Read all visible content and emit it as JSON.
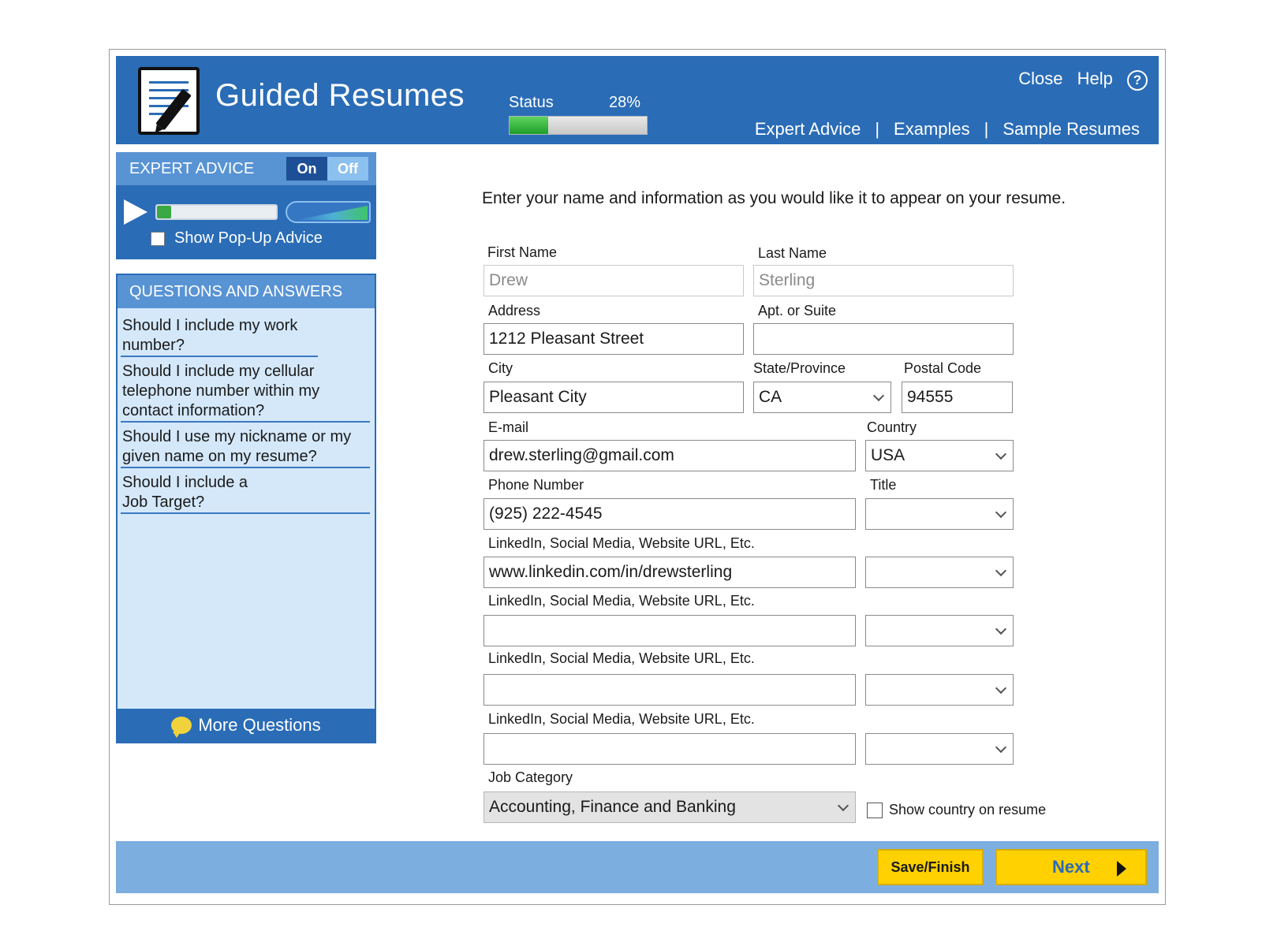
{
  "header": {
    "app_title": "Guided Resumes",
    "status_label": "Status",
    "status_percent": "28%",
    "status_progress": 0.28,
    "close_label": "Close",
    "help_label": "Help",
    "help_icon": "?",
    "nav": [
      "Expert Advice",
      "Examples",
      "Sample Resumes"
    ],
    "nav_separator": "|"
  },
  "expert_advice": {
    "title": "EXPERT ADVICE",
    "toggle_on": "On",
    "toggle_off": "Off",
    "show_popup_label": "Show Pop-Up Advice",
    "show_popup_checked": false
  },
  "qa": {
    "title": "QUESTIONS AND ANSWERS",
    "items": [
      "Should I include my work number?",
      "Should I include my cellular telephone number within my contact information?",
      "Should I use my nickname or my given name on my resume?",
      "Should I include a Job Target?"
    ],
    "more_label": "More Questions"
  },
  "form": {
    "intro": "Enter your name and information as you would like it to appear on your resume.",
    "first_name": {
      "label": "First Name",
      "value": "Drew"
    },
    "last_name": {
      "label": "Last Name",
      "value": "Sterling"
    },
    "address": {
      "label": "Address",
      "value": "1212 Pleasant Street"
    },
    "apt": {
      "label": "Apt. or Suite",
      "value": ""
    },
    "city": {
      "label": "City",
      "value": "Pleasant City"
    },
    "state": {
      "label": "State/Province",
      "value": "CA"
    },
    "postal": {
      "label": "Postal Code",
      "value": "94555"
    },
    "email": {
      "label": "E-mail",
      "value": "drew.sterling@gmail.com"
    },
    "country": {
      "label": "Country",
      "value": "USA"
    },
    "phone": {
      "label": "Phone Number",
      "value": "(925) 222-4545"
    },
    "title": {
      "label": "Title",
      "value": ""
    },
    "links": [
      {
        "label": "LinkedIn, Social Media, Website URL, Etc.",
        "value": "www.linkedin.com/in/drewsterling",
        "type": ""
      },
      {
        "label": "LinkedIn, Social Media, Website URL, Etc.",
        "value": "",
        "type": ""
      },
      {
        "label": "LinkedIn, Social Media, Website URL, Etc.",
        "value": "",
        "type": ""
      },
      {
        "label": "LinkedIn, Social Media, Website URL, Etc.",
        "value": "",
        "type": ""
      }
    ],
    "job_category": {
      "label": "Job Category",
      "value": "Accounting, Finance and Banking"
    },
    "show_country_label": "Show country on resume",
    "show_country_checked": false
  },
  "footer": {
    "save_label": "Save/Finish",
    "next_label": "Next"
  },
  "colors": {
    "header_blue": "#2a6cb6",
    "panel_light": "#d4e8fa",
    "button_yellow": "#ffd100",
    "footer_blue": "#7daee0"
  }
}
